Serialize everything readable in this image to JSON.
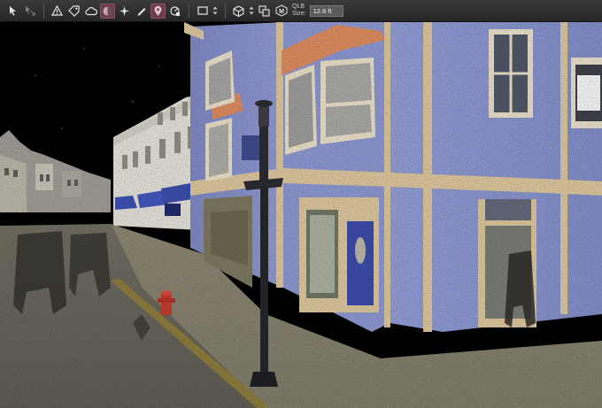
{
  "toolbar": {
    "tools": [
      {
        "icon": "arrow-icon"
      },
      {
        "icon": "measure-arrow-icon"
      },
      {
        "icon": "warning-triangle-icon"
      },
      {
        "icon": "tag-icon"
      },
      {
        "icon": "cloud-icon"
      },
      {
        "icon": "shading-icon",
        "active": true
      },
      {
        "icon": "sparkle-icon"
      },
      {
        "icon": "pen-icon"
      },
      {
        "icon": "location-pin-icon",
        "active": true
      },
      {
        "icon": "limit-box-icon"
      },
      {
        "icon": "square-view-icon"
      },
      {
        "icon": "cube-view-icon"
      },
      {
        "icon": "layers-icon"
      },
      {
        "icon": "qlb-m-icon"
      }
    ],
    "qlb_line1": "QLB",
    "qlb_line2": "Size:",
    "size_value": "12.8 ft"
  }
}
